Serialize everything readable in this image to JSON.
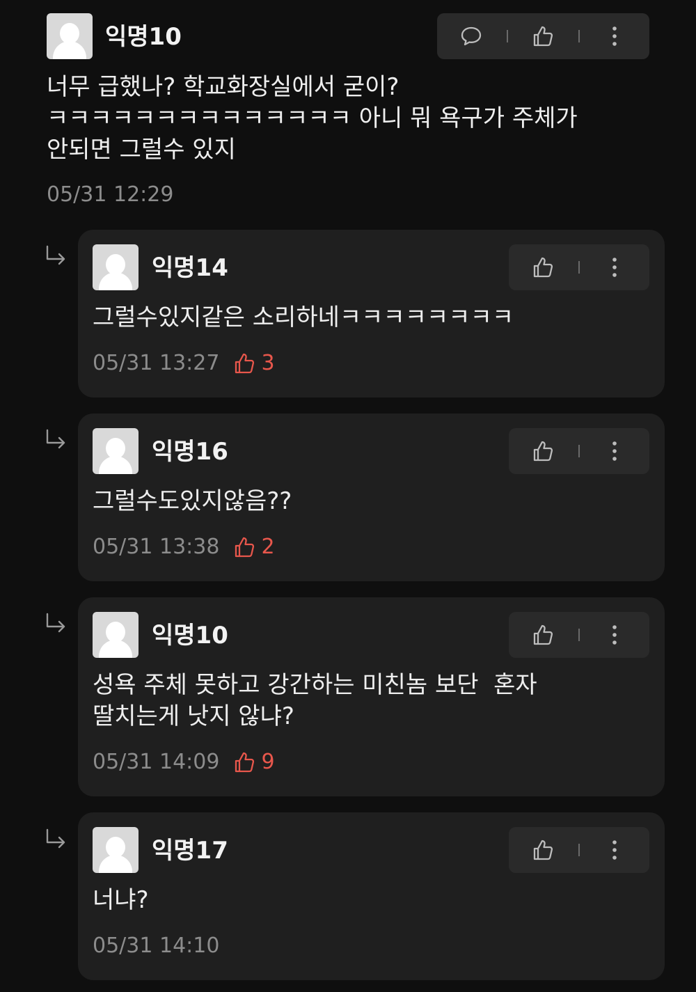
{
  "comments": [
    {
      "author": "익명10",
      "lines": [
        "너무 급했나? 학교화장실에서 굳이?",
        "ㅋㅋㅋㅋㅋㅋㅋㅋㅋㅋㅋㅋㅋㅋ 아니 뭐 욕구가 주체가",
        "안되면 그럴수 있지"
      ],
      "timestamp": "05/31 12:29",
      "icons": {
        "comment": "speech-bubble-icon",
        "like": "thumbs-up-icon",
        "more": "kebab-menu-icon"
      }
    }
  ],
  "replies": [
    {
      "author": "익명14",
      "lines": [
        "그럴수있지같은 소리하네ㅋㅋㅋㅋㅋㅋㅋㅋ"
      ],
      "timestamp": "05/31 13:27",
      "likes": "3"
    },
    {
      "author": "익명16",
      "lines": [
        "그럴수도있지않음??"
      ],
      "timestamp": "05/31 13:38",
      "likes": "2"
    },
    {
      "author": "익명10",
      "lines": [
        "성욕 주체 못하고 강간하는 미친놈 보단  혼자",
        "딸치는게 낫지 않냐?"
      ],
      "timestamp": "05/31 14:09",
      "likes": "9"
    },
    {
      "author": "익명17",
      "lines": [
        "너냐?"
      ],
      "timestamp": "05/31 14:10",
      "likes": ""
    }
  ],
  "colors": {
    "background": "#0f0f0f",
    "card": "#1f1f1f",
    "action_bar": "#2a2a2a",
    "like_accent": "#e8574c",
    "muted_text": "#8c8c8c"
  }
}
